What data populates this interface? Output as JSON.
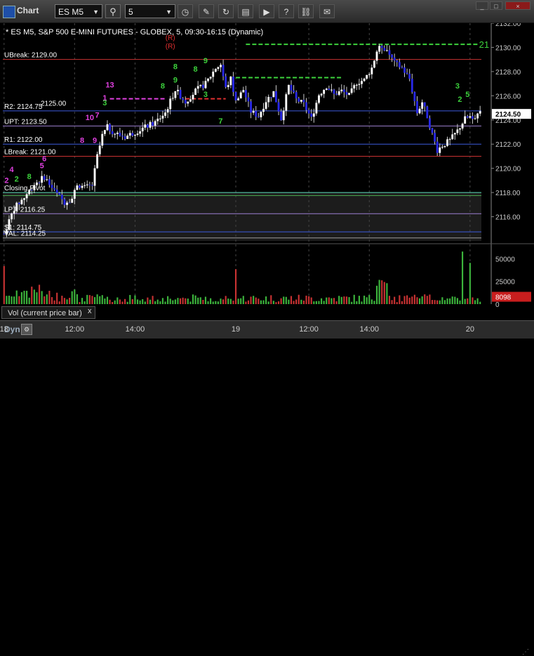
{
  "window": {
    "title": "Chart",
    "symbol": "ES M5",
    "interval": "5",
    "minimize_label": "_",
    "maximize_label": "□",
    "close_label": "×"
  },
  "toolbar_icons": [
    "search-icon",
    "clock-icon",
    "pencil-icon",
    "refresh-icon",
    "data-icon",
    "play-icon",
    "question-icon",
    "link-icon",
    "chat-icon"
  ],
  "chart_data": {
    "type": "candlestick",
    "title": "* ES M5, S&P 500 E-MINI FUTURES - GLOBEX, 5, 09:30-16:15 (Dynamic)",
    "y_axis": {
      "min": 2114,
      "max": 2132,
      "ticks": [
        2116,
        2118,
        2120,
        2122,
        2124,
        2126,
        2128,
        2130,
        2132
      ]
    },
    "current_price": "2124.50",
    "x_axis_labels": [
      {
        "label": "18",
        "bar": 0
      },
      {
        "label": "12:00",
        "bar": 28
      },
      {
        "label": "14:00",
        "bar": 52
      },
      {
        "label": "19",
        "bar": 92
      },
      {
        "label": "12:00",
        "bar": 121
      },
      {
        "label": "14:00",
        "bar": 145
      },
      {
        "label": "20",
        "bar": 185
      }
    ],
    "horizontal_levels": [
      {
        "label": "UBreak: 2129.00",
        "price": 2129.0,
        "color": "#c83232"
      },
      {
        "label": "R2: 2124.75",
        "price": 2124.75,
        "color": "#3c5adc"
      },
      {
        "label": "UPT: 2123.50",
        "price": 2123.5,
        "color": "#9b7fd1"
      },
      {
        "label": "R1: 2122.00",
        "price": 2122.0,
        "color": "#3c5adc"
      },
      {
        "label": "LBreak: 2121.00",
        "price": 2121.0,
        "color": "#c83232"
      },
      {
        "label": "Closing Pivot",
        "price": 2118.0,
        "color": "#60e0c0"
      },
      {
        "label": "",
        "price": 2117.75,
        "color": "#4caf50"
      },
      {
        "label": "LPT: 2116.25",
        "price": 2116.25,
        "color": "#9b7fd1"
      },
      {
        "label": "S1: 2114.75",
        "price": 2114.75,
        "color": "#3c5adc"
      },
      {
        "label": "VAL: 2114.25",
        "price": 2114.25,
        "color": "#999"
      }
    ],
    "overlap_label": "2125.00",
    "dashed_levels": [
      {
        "price": 2130.25,
        "from_bar": 96,
        "to_bar": 188,
        "color": "#3cd23c",
        "label": "21"
      },
      {
        "price": 2127.5,
        "from_bar": 92,
        "to_bar": 134,
        "color": "#3cd23c",
        "label": ""
      },
      {
        "price": 2125.75,
        "from_bar": 42,
        "to_bar": 64,
        "color": "#e040e0",
        "label": ""
      },
      {
        "price": 2125.75,
        "from_bar": 72,
        "to_bar": 88,
        "color": "#e03030",
        "label": ""
      }
    ],
    "r_markers": [
      {
        "label": "(R)",
        "bar": 66,
        "price": 2130.6
      },
      {
        "label": "(R)",
        "bar": 66,
        "price": 2129.9
      }
    ],
    "setup_numbers": [
      {
        "label": "13",
        "bar": 42,
        "price": 2126.7,
        "color": "#e040e0"
      },
      {
        "label": "1",
        "bar": 40,
        "price": 2125.6,
        "color": "#e040e0"
      },
      {
        "label": "10",
        "bar": 34,
        "price": 2124.0,
        "color": "#e040e0"
      },
      {
        "label": "7",
        "bar": 37,
        "price": 2124.2,
        "color": "#e040e0"
      },
      {
        "label": "8",
        "bar": 31,
        "price": 2122.1,
        "color": "#e040e0"
      },
      {
        "label": "9",
        "bar": 36,
        "price": 2122.1,
        "color": "#e040e0"
      },
      {
        "label": "6",
        "bar": 16,
        "price": 2120.6,
        "color": "#e040e0"
      },
      {
        "label": "5",
        "bar": 15,
        "price": 2120.0,
        "color": "#e040e0"
      },
      {
        "label": "4",
        "bar": 3,
        "price": 2119.7,
        "color": "#e040e0"
      },
      {
        "label": "2",
        "bar": 1,
        "price": 2118.8,
        "color": "#e040e0"
      },
      {
        "label": "8",
        "bar": 68,
        "price": 2128.2,
        "color": "#3cd23c"
      },
      {
        "label": "9",
        "bar": 80,
        "price": 2128.7,
        "color": "#3cd23c"
      },
      {
        "label": "8",
        "bar": 76,
        "price": 2128.0,
        "color": "#3cd23c"
      },
      {
        "label": "9",
        "bar": 68,
        "price": 2127.1,
        "color": "#3cd23c"
      },
      {
        "label": "8",
        "bar": 63,
        "price": 2126.6,
        "color": "#3cd23c"
      },
      {
        "label": "3",
        "bar": 80,
        "price": 2125.9,
        "color": "#3cd23c"
      },
      {
        "label": "3",
        "bar": 180,
        "price": 2126.6,
        "color": "#3cd23c"
      },
      {
        "label": "5",
        "bar": 184,
        "price": 2125.9,
        "color": "#3cd23c"
      },
      {
        "label": "2",
        "bar": 181,
        "price": 2125.5,
        "color": "#3cd23c"
      },
      {
        "label": "7",
        "bar": 86,
        "price": 2123.7,
        "color": "#3cd23c"
      },
      {
        "label": "3",
        "bar": 40,
        "price": 2125.2,
        "color": "#3cd23c"
      },
      {
        "label": "8",
        "bar": 10,
        "price": 2119.1,
        "color": "#3cd23c"
      },
      {
        "label": "2",
        "bar": 5,
        "price": 2118.9,
        "color": "#3cd23c"
      }
    ],
    "volume": {
      "label": "Vol (current price bar)",
      "close_label": "x",
      "current": "8098",
      "axis_ticks": [
        {
          "label": "50000",
          "value": 50000
        },
        {
          "label": "25000",
          "value": 25000
        },
        {
          "label": "0",
          "value": 0
        }
      ],
      "max": 62000
    },
    "candles": {
      "count": 190,
      "anchors": [
        [
          0,
          2114.6
        ],
        [
          4,
          2116.7
        ],
        [
          8,
          2117.6
        ],
        [
          12,
          2118.7
        ],
        [
          16,
          2119.3
        ],
        [
          20,
          2118.1
        ],
        [
          24,
          2117.2
        ],
        [
          27,
          2117.5
        ],
        [
          29,
          2118.7
        ],
        [
          32,
          2118.4
        ],
        [
          35,
          2118.6
        ],
        [
          37,
          2121.0
        ],
        [
          39,
          2122.7
        ],
        [
          41,
          2123.4
        ],
        [
          44,
          2122.9
        ],
        [
          48,
          2122.6
        ],
        [
          52,
          2123.0
        ],
        [
          56,
          2123.4
        ],
        [
          60,
          2123.8
        ],
        [
          64,
          2124.6
        ],
        [
          68,
          2126.5
        ],
        [
          72,
          2125.5
        ],
        [
          76,
          2126.4
        ],
        [
          80,
          2127.0
        ],
        [
          84,
          2128.3
        ],
        [
          86,
          2128.6
        ],
        [
          88,
          2126.6
        ],
        [
          90,
          2127.4
        ],
        [
          92,
          2125.5
        ],
        [
          95,
          2126.5
        ],
        [
          98,
          2124.7
        ],
        [
          101,
          2124.3
        ],
        [
          104,
          2125.6
        ],
        [
          107,
          2126.3
        ],
        [
          110,
          2124.1
        ],
        [
          113,
          2126.8
        ],
        [
          116,
          2125.7
        ],
        [
          119,
          2125.3
        ],
        [
          122,
          2124.1
        ],
        [
          125,
          2126.1
        ],
        [
          128,
          2126.8
        ],
        [
          131,
          2126.1
        ],
        [
          134,
          2126.4
        ],
        [
          137,
          2126.0
        ],
        [
          140,
          2127.1
        ],
        [
          143,
          2127.3
        ],
        [
          146,
          2128.3
        ],
        [
          148,
          2129.7
        ],
        [
          150,
          2130.1
        ],
        [
          152,
          2129.8
        ],
        [
          155,
          2128.7
        ],
        [
          158,
          2128.3
        ],
        [
          161,
          2127.4
        ],
        [
          164,
          2124.6
        ],
        [
          166,
          2125.5
        ],
        [
          168,
          2124.3
        ],
        [
          170,
          2122.8
        ],
        [
          172,
          2121.5
        ],
        [
          174,
          2121.9
        ],
        [
          177,
          2122.3
        ],
        [
          180,
          2123.1
        ],
        [
          183,
          2124.1
        ],
        [
          186,
          2124.3
        ],
        [
          189,
          2124.5
        ]
      ],
      "down_color": "#2828e6",
      "up_color": "#ffffff"
    }
  }
}
